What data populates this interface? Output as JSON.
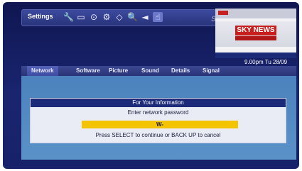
{
  "toolbar": {
    "label": "Settings",
    "icons": [
      {
        "name": "wrench-icon",
        "glyph": "🔧"
      },
      {
        "name": "tv-screen-icon",
        "glyph": "▭"
      },
      {
        "name": "record-icon",
        "glyph": "⊙"
      },
      {
        "name": "interactive-icon",
        "glyph": "⚙"
      },
      {
        "name": "diamond-icon",
        "glyph": "◇"
      },
      {
        "name": "search-icon",
        "glyph": "🔍"
      },
      {
        "name": "speaker-icon",
        "glyph": "◄"
      },
      {
        "name": "hand-icon",
        "glyph": "☝"
      }
    ],
    "brand": "sky"
  },
  "preview": {
    "channel_logo": "SKY NEWS"
  },
  "clock": "9.00pm Tu 28/09",
  "tabs": [
    {
      "label": "Network",
      "active": true
    },
    {
      "label": "Software",
      "active": false
    },
    {
      "label": "Picture",
      "active": false
    },
    {
      "label": "Sound",
      "active": false
    },
    {
      "label": "Details",
      "active": false
    },
    {
      "label": "Signal",
      "active": false
    }
  ],
  "dialog": {
    "title": "For Your Information",
    "prompt": "Enter network password",
    "input_value": "W-",
    "hint": "Press SELECT to continue or BACK UP to cancel"
  },
  "colors": {
    "background": "#1a2570",
    "tab_bar": "#2a3478",
    "content_panel": "#4c82bd",
    "dialog_header": "#1d2a7a",
    "input_highlight": "#f5c400",
    "sky_red": "#c81e1e"
  }
}
